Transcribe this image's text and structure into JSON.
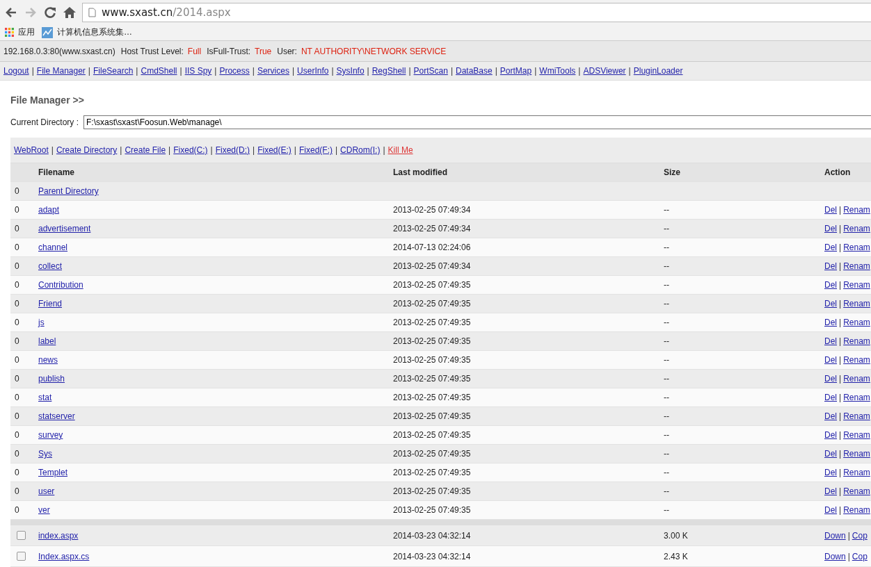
{
  "browser": {
    "url_host": "www.sxast.cn",
    "url_path": "/2014.aspx",
    "bookmarks": [
      {
        "kind": "apps",
        "label": "应用"
      },
      {
        "kind": "site",
        "label": "计算机信息系统集…"
      }
    ]
  },
  "info_bar": {
    "host": "192.168.0.3:80(www.sxast.cn)",
    "fields": [
      {
        "label": "Host Trust Level:",
        "value": "Full"
      },
      {
        "label": "IsFull-Trust:",
        "value": "True"
      },
      {
        "label": "User:",
        "value": "NT AUTHORITY\\NETWORK SERVICE"
      }
    ]
  },
  "nav_links": [
    {
      "label": "Logout",
      "separator": "|"
    },
    {
      "label": "File Manager",
      "separator": "|"
    },
    {
      "label": "FileSearch",
      "separator": "|"
    },
    {
      "label": "CmdShell",
      "separator": "|"
    },
    {
      "label": "IIS Spy",
      "separator": "|"
    },
    {
      "label": "Process",
      "separator": "|"
    },
    {
      "label": "Services",
      "separator": "|"
    },
    {
      "label": "UserInfo",
      "separator": "|"
    },
    {
      "label": "SysInfo",
      "separator": "|"
    },
    {
      "label": "RegShell",
      "separator": "|"
    },
    {
      "label": "PortScan",
      "separator": "|"
    },
    {
      "label": "DataBase",
      "separator": "|"
    },
    {
      "label": "PortMap",
      "separator": "|"
    },
    {
      "label": "WmiTools",
      "separator": "|"
    },
    {
      "label": "ADSViewer",
      "separator": "|"
    },
    {
      "label": "PluginLoader"
    }
  ],
  "heading": "File Manager >>",
  "current_directory": {
    "label": "Current Directory :",
    "value": "F:\\sxast\\sxast\\Foosun.Web\\manage\\"
  },
  "tool_links": [
    {
      "kind": "normal",
      "label": "WebRoot",
      "separator": "|"
    },
    {
      "kind": "normal",
      "label": "Create Directory",
      "separator": "|"
    },
    {
      "kind": "normal",
      "label": "Create File",
      "separator": "|"
    },
    {
      "kind": "normal",
      "label": "Fixed(C:)",
      "separator": "|"
    },
    {
      "kind": "normal",
      "label": "Fixed(D:)",
      "separator": "|"
    },
    {
      "kind": "normal",
      "label": "Fixed(E:)",
      "separator": "|"
    },
    {
      "kind": "normal",
      "label": "Fixed(F:)",
      "separator": "|"
    },
    {
      "kind": "normal",
      "label": "CDRom(I:)",
      "separator": "|"
    },
    {
      "kind": "danger",
      "label": "Kill Me"
    }
  ],
  "table": {
    "columns": [
      "Filename",
      "Last modified",
      "Size",
      "Action"
    ],
    "action_separator": "|",
    "rows": [
      {
        "kind": "parent",
        "index": "0",
        "name": "Parent Directory"
      },
      {
        "kind": "dir",
        "index": "0",
        "name": "adapt",
        "modified": "2013-02-25 07:49:34",
        "size": "--",
        "actions": [
          "Del",
          "Renam"
        ]
      },
      {
        "kind": "dir",
        "index": "0",
        "name": "advertisement",
        "modified": "2013-02-25 07:49:34",
        "size": "--",
        "actions": [
          "Del",
          "Renam"
        ]
      },
      {
        "kind": "dir",
        "index": "0",
        "name": "channel",
        "modified": "2014-07-13 02:24:06",
        "size": "--",
        "actions": [
          "Del",
          "Renam"
        ]
      },
      {
        "kind": "dir",
        "index": "0",
        "name": "collect",
        "modified": "2013-02-25 07:49:34",
        "size": "--",
        "actions": [
          "Del",
          "Renam"
        ]
      },
      {
        "kind": "dir",
        "index": "0",
        "name": "Contribution",
        "modified": "2013-02-25 07:49:35",
        "size": "--",
        "actions": [
          "Del",
          "Renam"
        ]
      },
      {
        "kind": "dir",
        "index": "0",
        "name": "Friend",
        "modified": "2013-02-25 07:49:35",
        "size": "--",
        "actions": [
          "Del",
          "Renam"
        ]
      },
      {
        "kind": "dir",
        "index": "0",
        "name": "js",
        "modified": "2013-02-25 07:49:35",
        "size": "--",
        "actions": [
          "Del",
          "Renam"
        ]
      },
      {
        "kind": "dir",
        "index": "0",
        "name": "label",
        "modified": "2013-02-25 07:49:35",
        "size": "--",
        "actions": [
          "Del",
          "Renam"
        ]
      },
      {
        "kind": "dir",
        "index": "0",
        "name": "news",
        "modified": "2013-02-25 07:49:35",
        "size": "--",
        "actions": [
          "Del",
          "Renam"
        ]
      },
      {
        "kind": "dir",
        "index": "0",
        "name": "publish",
        "modified": "2013-02-25 07:49:35",
        "size": "--",
        "actions": [
          "Del",
          "Renam"
        ]
      },
      {
        "kind": "dir",
        "index": "0",
        "name": "stat",
        "modified": "2013-02-25 07:49:35",
        "size": "--",
        "actions": [
          "Del",
          "Renam"
        ]
      },
      {
        "kind": "dir",
        "index": "0",
        "name": "statserver",
        "modified": "2013-02-25 07:49:35",
        "size": "--",
        "actions": [
          "Del",
          "Renam"
        ]
      },
      {
        "kind": "dir",
        "index": "0",
        "name": "survey",
        "modified": "2013-02-25 07:49:35",
        "size": "--",
        "actions": [
          "Del",
          "Renam"
        ]
      },
      {
        "kind": "dir",
        "index": "0",
        "name": "Sys",
        "modified": "2013-02-25 07:49:35",
        "size": "--",
        "actions": [
          "Del",
          "Renam"
        ]
      },
      {
        "kind": "dir",
        "index": "0",
        "name": "Templet",
        "modified": "2013-02-25 07:49:35",
        "size": "--",
        "actions": [
          "Del",
          "Renam"
        ]
      },
      {
        "kind": "dir",
        "index": "0",
        "name": "user",
        "modified": "2013-02-25 07:49:35",
        "size": "--",
        "actions": [
          "Del",
          "Renam"
        ]
      },
      {
        "kind": "dir",
        "index": "0",
        "name": "ver",
        "modified": "2013-02-25 07:49:35",
        "size": "--",
        "actions": [
          "Del",
          "Renam"
        ]
      },
      {
        "kind": "file",
        "checked": false,
        "name": "index.aspx",
        "modified": "2014-03-23 04:32:14",
        "size": "3.00 K",
        "actions": [
          "Down",
          "Cop"
        ]
      },
      {
        "kind": "file",
        "checked": false,
        "name": "Index.aspx.cs",
        "modified": "2014-03-23 04:32:14",
        "size": "2.43 K",
        "actions": [
          "Down",
          "Cop"
        ]
      }
    ]
  }
}
